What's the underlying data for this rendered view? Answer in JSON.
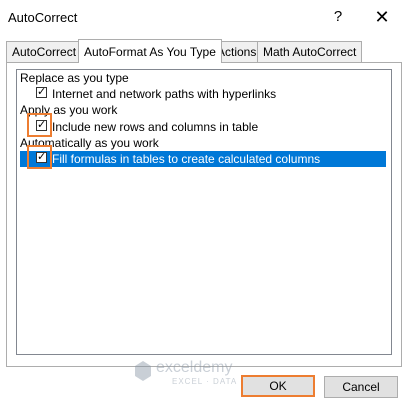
{
  "window": {
    "title": "AutoCorrect",
    "help_glyph": "?",
    "close_glyph": "✕"
  },
  "tabs": [
    {
      "label": "AutoCorrect",
      "active": false
    },
    {
      "label": "AutoFormat As You Type",
      "active": true
    },
    {
      "label": "Actions",
      "active": false
    },
    {
      "label": "Math AutoCorrect",
      "active": false
    }
  ],
  "groups": {
    "replace": "Replace as you type",
    "apply": "Apply as you work",
    "automatic": "Automatically as you work"
  },
  "options": [
    {
      "label": "Internet and network paths with hyperlinks",
      "checked": true
    },
    {
      "label": "Include new rows and columns in table",
      "checked": true
    },
    {
      "label": "Fill formulas in tables to create calculated columns",
      "checked": true,
      "selected": true
    }
  ],
  "check_glyph": "✓",
  "buttons": {
    "ok": "OK",
    "cancel": "Cancel"
  },
  "watermark": {
    "name": "exceldemy",
    "tagline": "EXCEL · DATA · BI"
  },
  "colors": {
    "highlight": "#ed7d31",
    "selection": "#0078d7"
  }
}
